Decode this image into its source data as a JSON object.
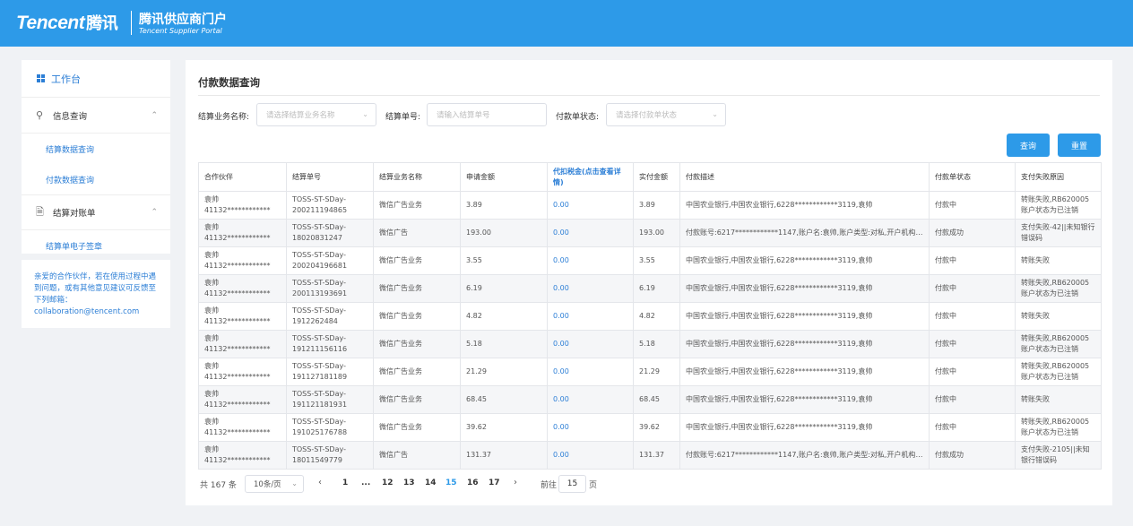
{
  "header": {
    "logo_en": "Tencent",
    "logo_cn": "腾讯",
    "portal_title": "腾讯供应商门户",
    "portal_subtitle": "Tencent Supplier Portal"
  },
  "sidebar": {
    "home_label": "工作台",
    "groups": [
      {
        "label": "信息查询",
        "items": [
          "结算数据查询",
          "付款数据查询"
        ]
      },
      {
        "label": "结算对账单",
        "items": [
          "结算单电子签章"
        ]
      }
    ],
    "notice": "亲爱的合作伙伴，若在使用过程中遇到问题，或有其他意见建议可反馈至下列邮箱：",
    "notice_email": "collaboration@tencent.com"
  },
  "main": {
    "title": "付款数据查询",
    "filters": {
      "business_label": "结算业务名称:",
      "business_placeholder": "请选择结算业务名称",
      "order_label": "结算单号:",
      "order_placeholder": "请输入结算单号",
      "status_label": "付款单状态:",
      "status_placeholder": "请选择付款单状态"
    },
    "buttons": {
      "query": "查询",
      "reset": "重置"
    },
    "table": {
      "headers": [
        "合作伙伴",
        "结算单号",
        "结算业务名称",
        "申请金额",
        "代扣税金(点击查看详情)",
        "实付金额",
        "付款描述",
        "付款单状态",
        "支付失败原因"
      ],
      "rows": [
        [
          "袁帅41132************",
          "TOSS-ST-SDay-200211194865",
          "微信广告业务",
          "3.89",
          "0.00",
          "3.89",
          "中国农业银行,中国农业银行,6228************3119,袁帅",
          "付款中",
          "转账失败,RB620005账户状态为已注销"
        ],
        [
          "袁帅41132************",
          "TOSS-ST-SDay-18020831247",
          "微信广告",
          "193.00",
          "0.00",
          "193.00",
          "付款账号:6217************1147,账户名:袁帅,账户类型:对私,开户机构:...",
          "付款成功",
          "支付失败-42||未知银行错误码"
        ],
        [
          "袁帅41132************",
          "TOSS-ST-SDay-200204196681",
          "微信广告业务",
          "3.55",
          "0.00",
          "3.55",
          "中国农业银行,中国农业银行,6228************3119,袁帅",
          "付款中",
          "转账失败"
        ],
        [
          "袁帅41132************",
          "TOSS-ST-SDay-200113193691",
          "微信广告业务",
          "6.19",
          "0.00",
          "6.19",
          "中国农业银行,中国农业银行,6228************3119,袁帅",
          "付款中",
          "转账失败,RB620005账户状态为已注销"
        ],
        [
          "袁帅41132************",
          "TOSS-ST-SDay-1912262484",
          "微信广告业务",
          "4.82",
          "0.00",
          "4.82",
          "中国农业银行,中国农业银行,6228************3119,袁帅",
          "付款中",
          "转账失败"
        ],
        [
          "袁帅41132************",
          "TOSS-ST-SDay-191211156116",
          "微信广告业务",
          "5.18",
          "0.00",
          "5.18",
          "中国农业银行,中国农业银行,6228************3119,袁帅",
          "付款中",
          "转账失败,RB620005账户状态为已注销"
        ],
        [
          "袁帅41132************",
          "TOSS-ST-SDay-191127181189",
          "微信广告业务",
          "21.29",
          "0.00",
          "21.29",
          "中国农业银行,中国农业银行,6228************3119,袁帅",
          "付款中",
          "转账失败,RB620005账户状态为已注销"
        ],
        [
          "袁帅41132************",
          "TOSS-ST-SDay-191121181931",
          "微信广告业务",
          "68.45",
          "0.00",
          "68.45",
          "中国农业银行,中国农业银行,6228************3119,袁帅",
          "付款中",
          "转账失败"
        ],
        [
          "袁帅41132************",
          "TOSS-ST-SDay-191025176788",
          "微信广告业务",
          "39.62",
          "0.00",
          "39.62",
          "中国农业银行,中国农业银行,6228************3119,袁帅",
          "付款中",
          "转账失败,RB620005账户状态为已注销"
        ],
        [
          "袁帅41132************",
          "TOSS-ST-SDay-18011549779",
          "微信广告",
          "131.37",
          "0.00",
          "131.37",
          "付款账号:6217************1147,账户名:袁帅,账户类型:对私,开户机构:...",
          "付款成功",
          "支付失败-2105||未知银行错误码"
        ]
      ]
    },
    "pagination": {
      "total": "共 167 条",
      "page_size": "10条/页",
      "pages": [
        "1",
        "...",
        "12",
        "13",
        "14",
        "15",
        "16",
        "17"
      ],
      "current": "15",
      "goto_label": "前往",
      "goto_value": "15",
      "goto_unit": "页"
    }
  }
}
